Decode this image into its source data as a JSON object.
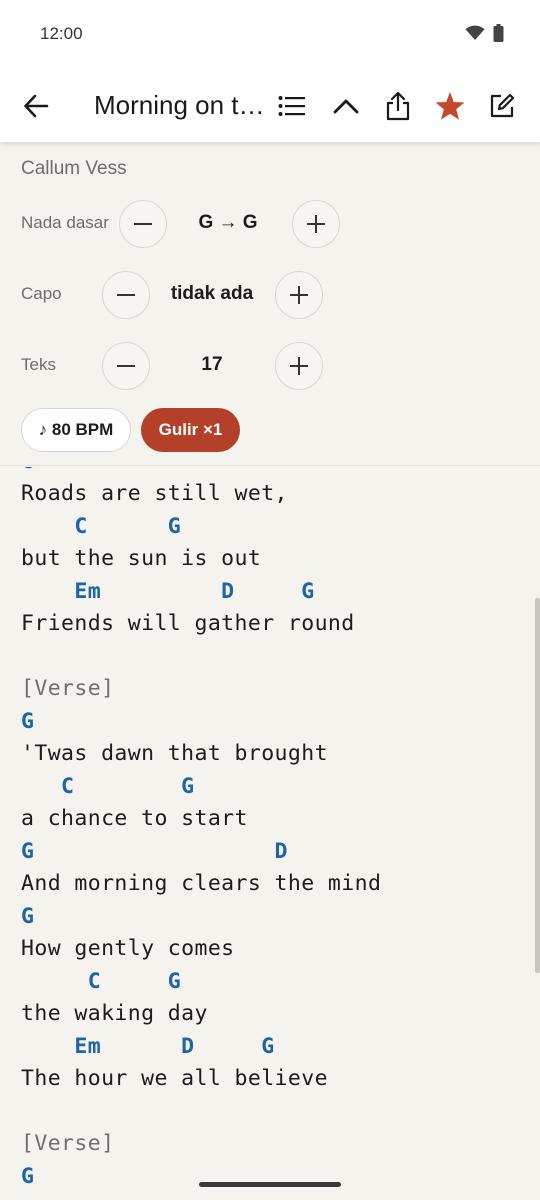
{
  "status": {
    "time": "12:00"
  },
  "appbar": {
    "title": "Morning on the Hill"
  },
  "song": {
    "artist": "Callum Vess"
  },
  "controls": {
    "key": {
      "label": "Nada dasar",
      "value": "G → G"
    },
    "capo": {
      "label": "Capo",
      "value": "tidak ada"
    },
    "text": {
      "label": "Teks",
      "value": "17"
    },
    "minus": "−",
    "plus": "+"
  },
  "chips": {
    "bpm": "♪ 80 BPM",
    "scroll": "Gulir ×1"
  },
  "colors": {
    "accent": "#b5402a",
    "chord": "#1f63a8",
    "star": "#c7472c"
  },
  "sheet": [
    {
      "type": "chord",
      "text": "G"
    },
    {
      "type": "lyric",
      "text": "Roads are still wet,"
    },
    {
      "type": "chord",
      "text": "    C      G"
    },
    {
      "type": "lyric",
      "text": "but the sun is out"
    },
    {
      "type": "chord",
      "text": "    Em         D     G"
    },
    {
      "type": "lyric",
      "text": "Friends will gather round"
    },
    {
      "type": "blank",
      "text": ""
    },
    {
      "type": "section",
      "text": "[Verse]"
    },
    {
      "type": "chord",
      "text": "G"
    },
    {
      "type": "lyric",
      "text": "'Twas dawn that brought"
    },
    {
      "type": "chord",
      "text": "   C        G"
    },
    {
      "type": "lyric",
      "text": "a chance to start"
    },
    {
      "type": "chord",
      "text": "G                  D"
    },
    {
      "type": "lyric",
      "text": "And morning clears the mind"
    },
    {
      "type": "chord",
      "text": "G"
    },
    {
      "type": "lyric",
      "text": "How gently comes"
    },
    {
      "type": "chord",
      "text": "     C     G"
    },
    {
      "type": "lyric",
      "text": "the waking day"
    },
    {
      "type": "chord",
      "text": "    Em      D     G"
    },
    {
      "type": "lyric",
      "text": "The hour we all believe"
    },
    {
      "type": "blank",
      "text": ""
    },
    {
      "type": "section",
      "text": "[Verse]"
    },
    {
      "type": "chord",
      "text": "G"
    }
  ]
}
